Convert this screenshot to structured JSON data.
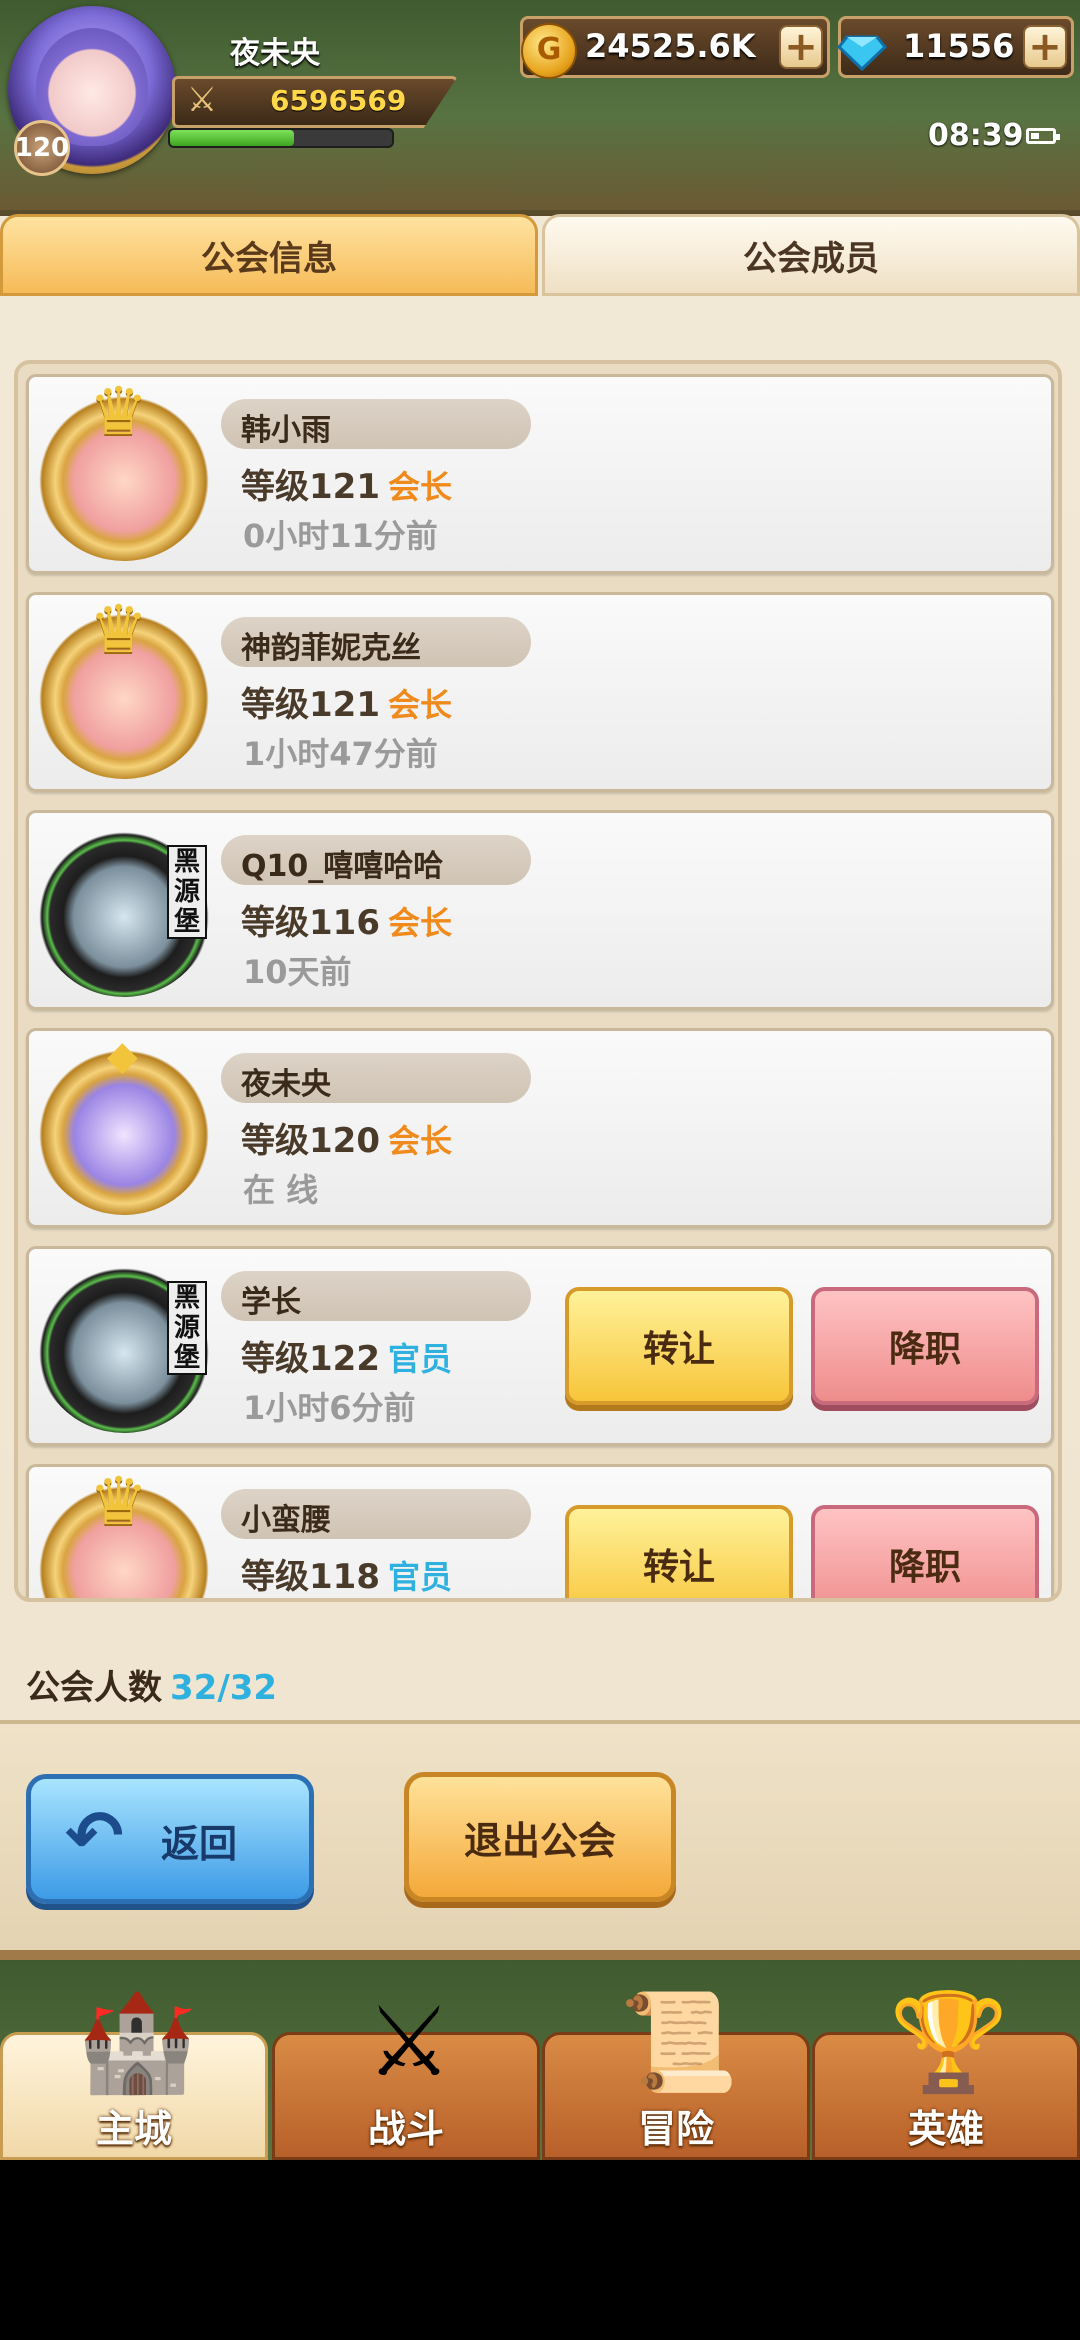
{
  "player": {
    "name": "夜未央",
    "level": "120",
    "power": "6596569",
    "xp_fraction": 0.56
  },
  "currencies": {
    "gold": "24525.6K",
    "gems": "11556",
    "gold_icon": "coin-icon",
    "gem_icon": "diamond-icon"
  },
  "status": {
    "time": "08:39"
  },
  "tabs": [
    {
      "label": "公会信息",
      "active": true
    },
    {
      "label": "公会成员",
      "active": false
    }
  ],
  "members": [
    {
      "name": "韩小雨",
      "level": "等级121",
      "role": "会长",
      "last_seen": "0小时11分前",
      "avatar": "crown-frame-avatar",
      "actions": []
    },
    {
      "name": "神韵菲妮克丝",
      "level": "等级121",
      "role": "会长",
      "last_seen": "1小时47分前",
      "avatar": "crown-frame-avatar",
      "actions": []
    },
    {
      "name": "Q10_嘻嘻哈哈",
      "level": "等级116",
      "role": "会长",
      "last_seen": "10天前",
      "avatar": "dark-frame-avatar",
      "actions": []
    },
    {
      "name": "夜未央",
      "level": "等级120",
      "role": "会长",
      "last_seen": "在 线",
      "avatar": "gold-frame-avatar",
      "actions": []
    },
    {
      "name": "学长",
      "level": "等级122",
      "role": "官员",
      "last_seen": "1小时6分前",
      "avatar": "dark-frame-avatar",
      "actions": [
        "转让",
        "降职"
      ]
    },
    {
      "name": "小蛮腰",
      "level": "等级118",
      "role": "官员",
      "last_seen": "",
      "avatar": "crown-frame-avatar",
      "actions": [
        "转让",
        "降职"
      ]
    }
  ],
  "footer": {
    "count_label": "公会人数",
    "count_value": "32/32",
    "back_label": "返回",
    "leave_label": "退出公会"
  },
  "nav": [
    {
      "label": "主城",
      "icon": "castle-icon",
      "active": true
    },
    {
      "label": "战斗",
      "icon": "crossed-swords-icon",
      "active": false
    },
    {
      "label": "冒险",
      "icon": "scroll-map-icon",
      "active": false
    },
    {
      "label": "英雄",
      "icon": "hero-emblem-icon",
      "active": false
    }
  ],
  "colors": {
    "leader_role": "#f08a1c",
    "officer_role": "#2fb1e0",
    "count_value": "#2fb1e0"
  }
}
